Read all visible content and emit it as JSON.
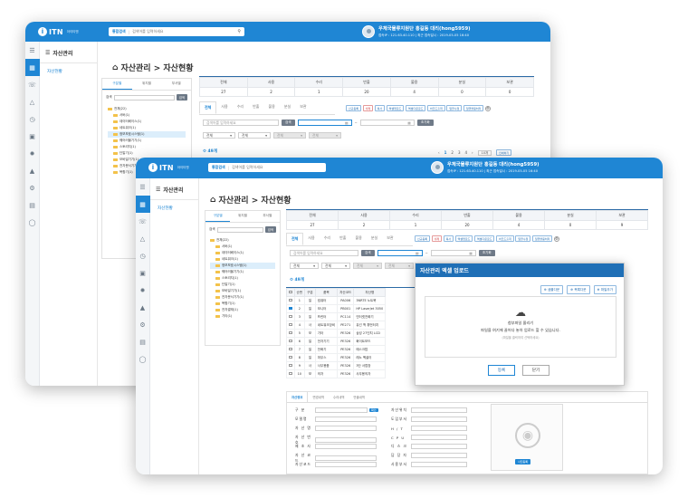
{
  "app": {
    "logo": "ITN",
    "logo_sub": "아이티엔",
    "search_label": "통합검색",
    "search_placeholder": "검색어를 입력하세요",
    "user_name": "우체국물류지원단 홍길동 대리(hong5959)",
    "user_ip": "접속IP : 121.63.40.110  |  최근 접속일시 : 2019-05-05 16:40"
  },
  "sidebar": {
    "title": "자산관리",
    "item": "자산현황",
    "icons": [
      "dashboard-icon",
      "support-icon",
      "warning-icon",
      "clock-icon",
      "monitor-icon",
      "settings-icon",
      "education-icon",
      "config-icon",
      "screen-icon",
      "shield-icon"
    ]
  },
  "page": {
    "title": "자산관리 > 자산현황"
  },
  "tree": {
    "tabs": [
      "구분별",
      "위치별",
      "부서별"
    ],
    "search_label": "검색",
    "search_btn": "검색",
    "nodes": [
      "전체(22)",
      "서버(1)",
      "데이터베이스(1)",
      "네트워크(1)",
      "정보보호시스템(1)",
      "웨어러블기기(1)",
      "스토리지(1)",
      "단말기(1)",
      "모바일기기(1)",
      "전자문서기기(1)",
      "복합기(1)",
      "전자결재(1)",
      "기타(1)"
    ]
  },
  "stats": {
    "headers": [
      "전체",
      "사용",
      "수리",
      "반출",
      "불용",
      "분실",
      "보관"
    ],
    "values_back": [
      "27",
      "2",
      "1",
      "20",
      "4",
      "0",
      "0"
    ],
    "values_front": [
      "27",
      "2",
      "1",
      "20",
      "4",
      "0",
      "9"
    ]
  },
  "tabs": [
    "전체",
    "사용",
    "수리",
    "반출",
    "불용",
    "분실",
    "보관"
  ],
  "actions": [
    "신규등록",
    "삭제",
    "복사",
    "엑셀업로드",
    "엑셀다운로드",
    "바코드출력",
    "일괄수정",
    "일괄불용처리"
  ],
  "filter": {
    "search_placeholder": "검색어를 입력하세요",
    "search_btn": "검색",
    "reset_btn": "초기화",
    "tilde": "~",
    "selects": [
      "전체",
      "전체",
      "전체",
      "전체"
    ]
  },
  "count": {
    "label": "49개"
  },
  "pager": {
    "pages": [
      "1",
      "2",
      "3",
      "4"
    ],
    "size": "10개",
    "print": "인쇄하기"
  },
  "grid": {
    "headers": [
      "",
      "순번",
      "구분",
      "품목",
      "자산코드",
      "자산명",
      "모델명"
    ],
    "rows": [
      [
        "1",
        "일",
        "컴퓨터",
        "PA006",
        "3NRTE 노트북"
      ],
      [
        "2",
        "일",
        "모니터",
        "PB001",
        "HP LaserJet 3050"
      ],
      [
        "3",
        "일",
        "프린터",
        "PC114",
        "인터넷전화기"
      ],
      [
        "4",
        "사",
        "네트워크장비",
        "PE271",
        "유선 백 휴먼터치"
      ],
      [
        "5",
        "보",
        "기타",
        "PE326",
        "삼성 27인치 LCD"
      ],
      [
        "6",
        "일",
        "전자기기",
        "PE326",
        "화이트보드"
      ],
      [
        "7",
        "일",
        "전화기",
        "PE326",
        "에스크탑"
      ],
      [
        "8",
        "일",
        "마우스",
        "PE326",
        "레노 벡골이"
      ],
      [
        "9",
        "사",
        "사무용품",
        "PE326",
        "3단 서랍장"
      ],
      [
        "10",
        "보",
        "의자",
        "PE326",
        "사무용의자"
      ]
    ]
  },
  "detail": {
    "tabs": [
      "자산정보",
      "변경내역",
      "수리내역",
      "반출내역"
    ],
    "left_labels": [
      "구 분",
      "모델명",
      "자 산 명",
      "자 산 번 호",
      "제 조 사",
      "자 산 코 드",
      "자산코드",
      "바코드번호"
    ],
    "right_labels": [
      "자산위치",
      "도입부서",
      "H / T",
      "C P U",
      "디 스 크",
      "담 당 자",
      "사용부서"
    ],
    "confirm_btn": "확인",
    "photo_btn": "사진등록"
  },
  "modal": {
    "title": "자산관리 엑셀 업로드",
    "buttons": [
      "샘플다운",
      "목록다운",
      "파일추가"
    ],
    "drop_line1": "첨부파일 올리기",
    "drop_line2": "파일을 여기에 끌어다 놓아 업로드 할 수 있습니다.",
    "drop_line3": "(파일을 클릭하여 선택하세요)",
    "ok": "등록",
    "cancel": "닫기"
  },
  "colors": {
    "primary": "#1f86d4",
    "header_dark": "#1f6fb6"
  }
}
